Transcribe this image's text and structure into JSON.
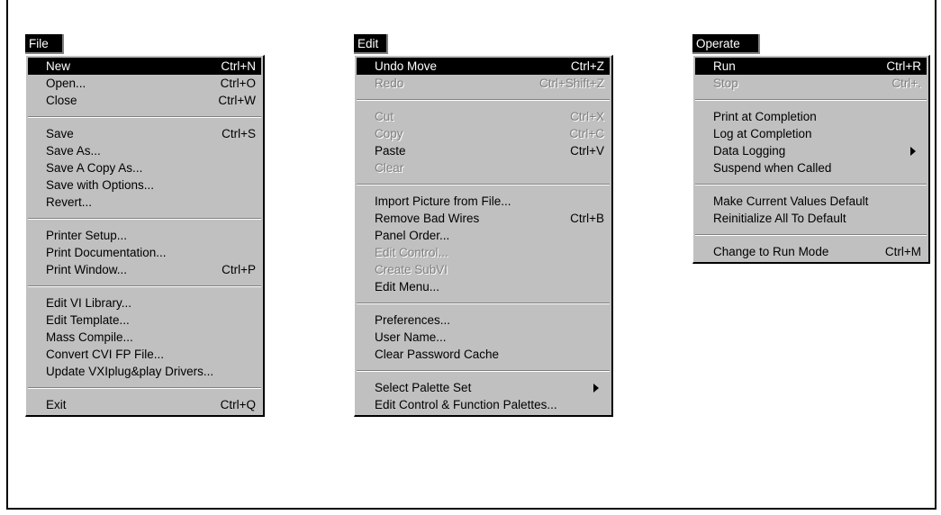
{
  "file_menu": {
    "title": "File",
    "groups": [
      [
        {
          "label": "New",
          "shortcut": "Ctrl+N"
        },
        {
          "label": "Open...",
          "shortcut": "Ctrl+O"
        },
        {
          "label": "Close",
          "shortcut": "Ctrl+W"
        }
      ],
      [
        {
          "label": "Save",
          "shortcut": "Ctrl+S"
        },
        {
          "label": "Save As...",
          "shortcut": ""
        },
        {
          "label": "Save A Copy As...",
          "shortcut": ""
        },
        {
          "label": "Save with Options...",
          "shortcut": ""
        },
        {
          "label": "Revert...",
          "shortcut": ""
        }
      ],
      [
        {
          "label": "Printer Setup...",
          "shortcut": ""
        },
        {
          "label": "Print Documentation...",
          "shortcut": ""
        },
        {
          "label": "Print Window...",
          "shortcut": "Ctrl+P"
        }
      ],
      [
        {
          "label": "Edit VI Library...",
          "shortcut": ""
        },
        {
          "label": "Edit Template...",
          "shortcut": ""
        },
        {
          "label": "Mass Compile...",
          "shortcut": ""
        },
        {
          "label": "Convert CVI FP File...",
          "shortcut": ""
        },
        {
          "label": "Update VXIplug&play Drivers...",
          "shortcut": ""
        }
      ],
      [
        {
          "label": "Exit",
          "shortcut": "Ctrl+Q"
        }
      ]
    ]
  },
  "edit_menu": {
    "title": "Edit",
    "groups": [
      [
        {
          "label": "Undo Move",
          "shortcut": "Ctrl+Z"
        },
        {
          "label": "Redo",
          "shortcut": "Ctrl+Shift+Z"
        }
      ],
      [
        {
          "label": "Cut",
          "shortcut": "Ctrl+X"
        },
        {
          "label": "Copy",
          "shortcut": "Ctrl+C"
        },
        {
          "label": "Paste",
          "shortcut": "Ctrl+V"
        },
        {
          "label": "Clear",
          "shortcut": ""
        }
      ],
      [
        {
          "label": "Import Picture from File...",
          "shortcut": ""
        },
        {
          "label": "Remove Bad Wires",
          "shortcut": "Ctrl+B"
        },
        {
          "label": "Panel Order...",
          "shortcut": ""
        },
        {
          "label": "Edit Control...",
          "shortcut": ""
        },
        {
          "label": "Create SubVI",
          "shortcut": ""
        },
        {
          "label": "Edit Menu...",
          "shortcut": ""
        }
      ],
      [
        {
          "label": "Preferences...",
          "shortcut": ""
        },
        {
          "label": "User Name...",
          "shortcut": ""
        },
        {
          "label": "Clear Password Cache",
          "shortcut": ""
        }
      ],
      [
        {
          "label": "Select Palette Set",
          "shortcut": ""
        },
        {
          "label": "Edit Control & Function Palettes...",
          "shortcut": ""
        }
      ]
    ]
  },
  "operate_menu": {
    "title": "Operate",
    "groups": [
      [
        {
          "label": "Run",
          "shortcut": "Ctrl+R"
        },
        {
          "label": "Stop",
          "shortcut": "Ctrl+."
        }
      ],
      [
        {
          "label": "Print at Completion",
          "shortcut": ""
        },
        {
          "label": "Log at Completion",
          "shortcut": ""
        },
        {
          "label": "Data Logging",
          "shortcut": ""
        },
        {
          "label": "Suspend when Called",
          "shortcut": ""
        }
      ],
      [
        {
          "label": "Make Current Values Default",
          "shortcut": ""
        },
        {
          "label": "Reinitialize All To Default",
          "shortcut": ""
        }
      ],
      [
        {
          "label": "Change to Run Mode",
          "shortcut": "Ctrl+M"
        }
      ]
    ]
  }
}
